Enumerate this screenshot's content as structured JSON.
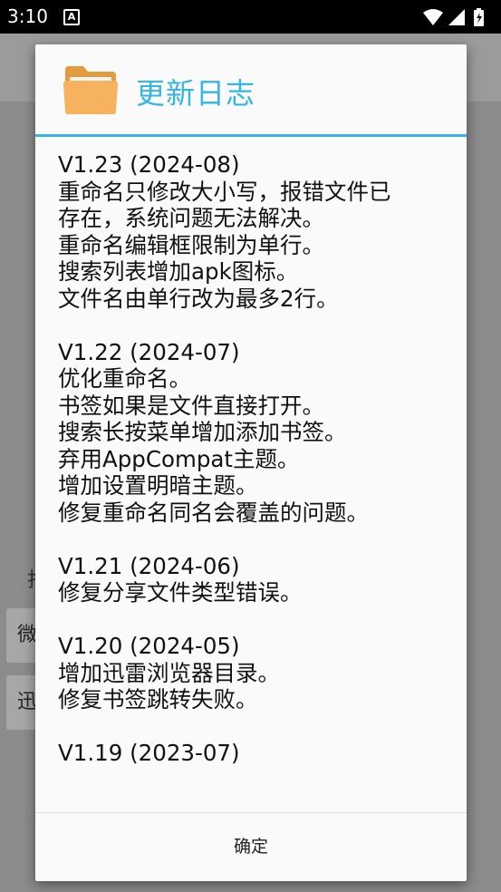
{
  "status_bar": {
    "time": "3:10",
    "badge": "A"
  },
  "background": {
    "btn1_label": "微",
    "btn2_label": "迅",
    "side_label": "打"
  },
  "dialog": {
    "title": "更新日志",
    "icon": "folder-icon",
    "accent_color": "#33b5e5",
    "entries": [
      {
        "version": "V1.23 (2024-08)",
        "lines": [
          "重命名只修改大小写，报错文件已",
          "存在，系统问题无法解决。",
          "重命名编辑框限制为单行。",
          "搜索列表增加apk图标。",
          "文件名由单行改为最多2行。"
        ]
      },
      {
        "version": "V1.22 (2024-07)",
        "lines": [
          "优化重命名。",
          "书签如果是文件直接打开。",
          "搜索长按菜单增加添加书签。",
          "弃用AppCompat主题。",
          "增加设置明暗主题。",
          "修复重命名同名会覆盖的问题。"
        ]
      },
      {
        "version": "V1.21 (2024-06)",
        "lines": [
          "修复分享文件类型错误。"
        ]
      },
      {
        "version": "V1.20 (2024-05)",
        "lines": [
          "增加迅雷浏览器目录。",
          "修复书签跳转失败。"
        ]
      },
      {
        "version": "V1.19 (2023-07)",
        "lines": []
      }
    ],
    "ok_label": "确定"
  }
}
